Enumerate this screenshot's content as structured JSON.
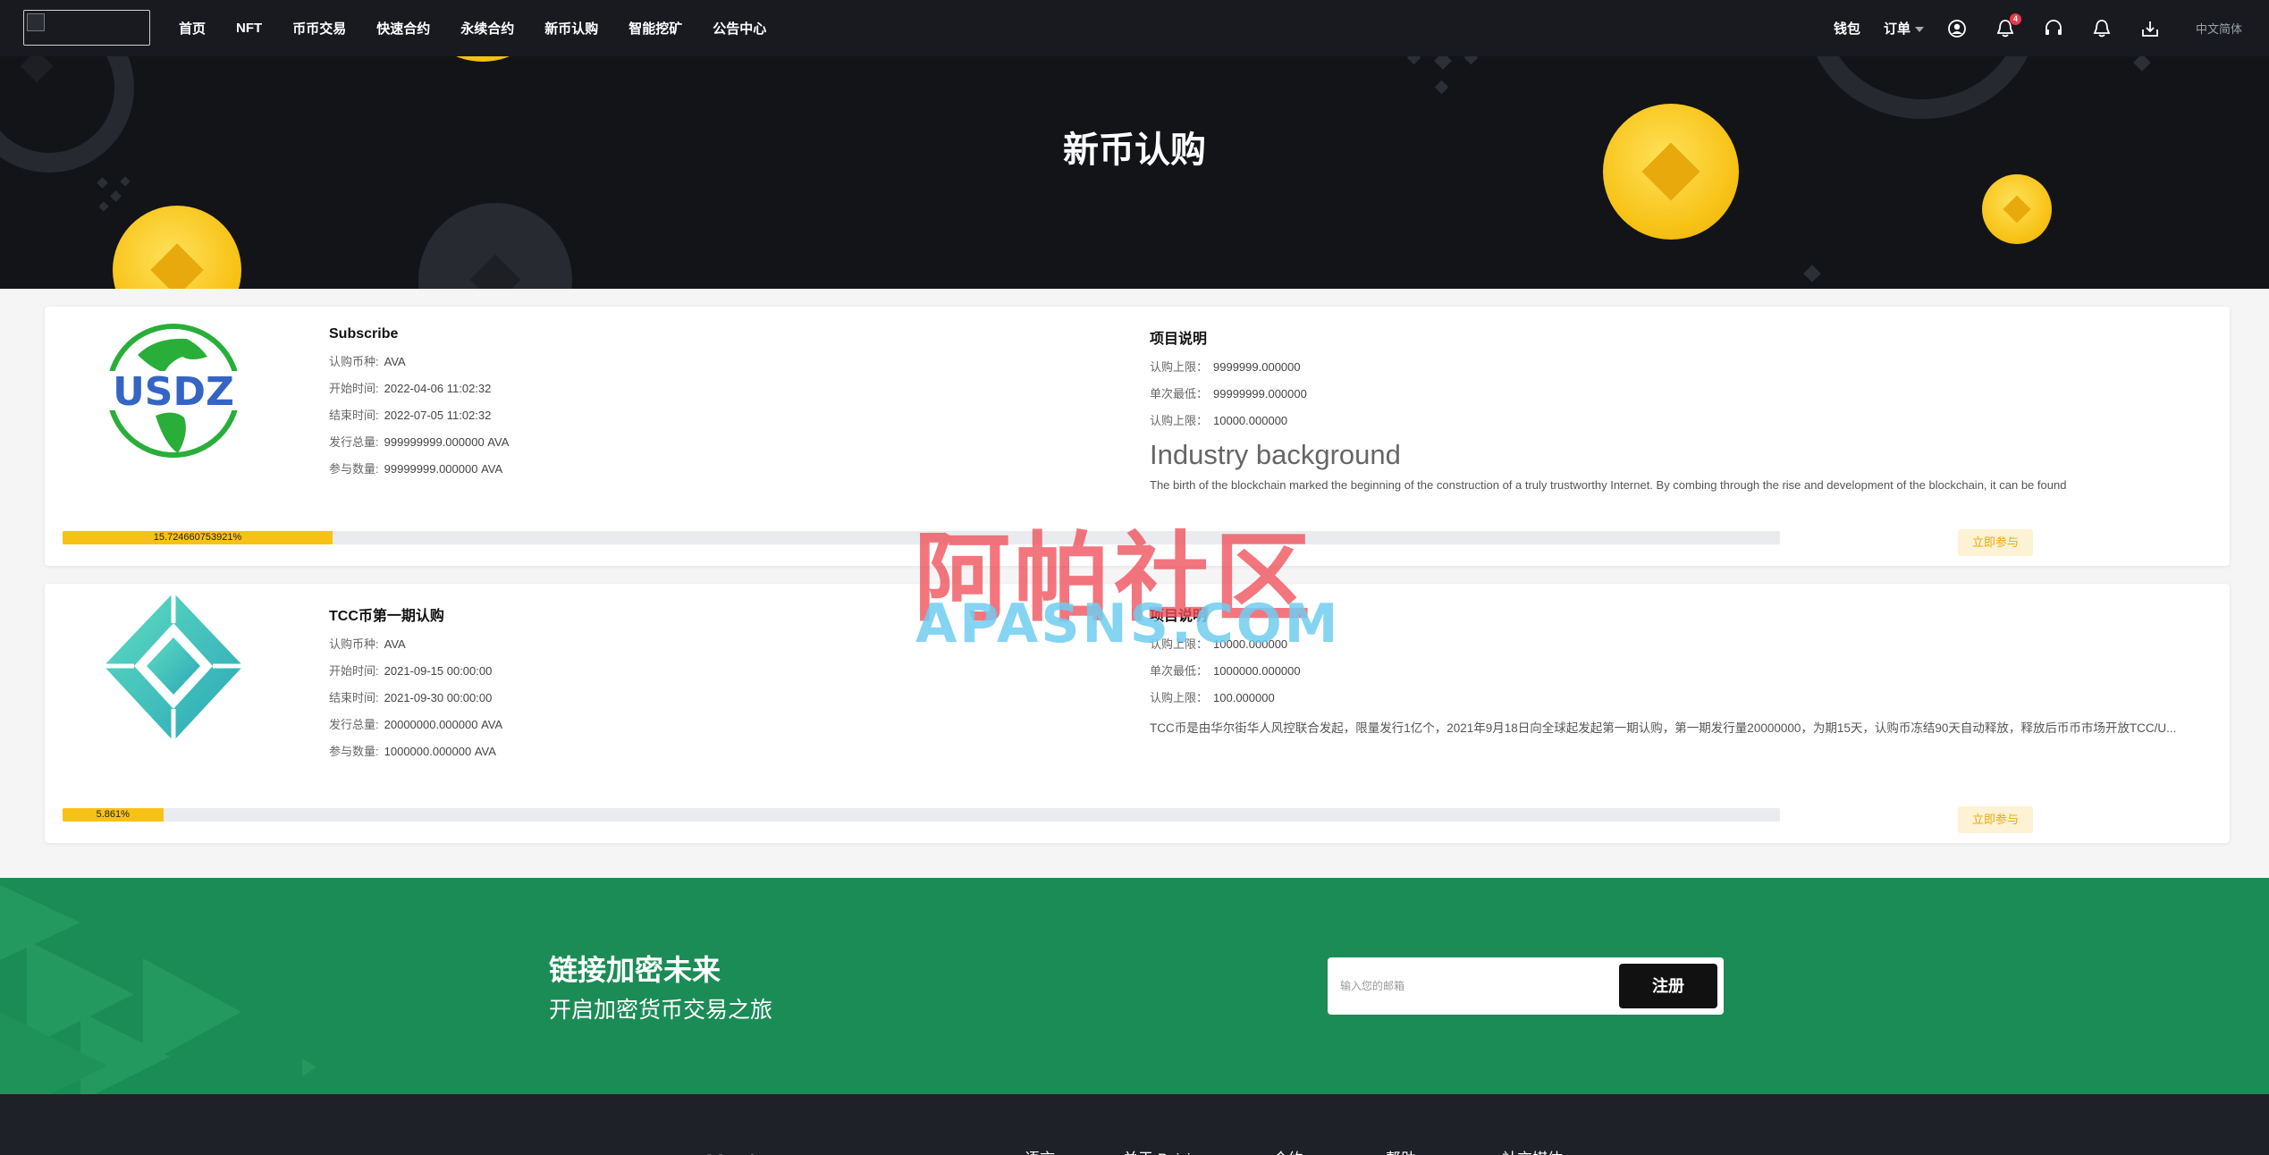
{
  "nav": {
    "items": [
      "首页",
      "NFT",
      "币币交易",
      "快速合约",
      "永续合约",
      "新币认购",
      "智能挖矿",
      "公告中心"
    ],
    "wallet": "钱包",
    "orders": "订单",
    "notification_count": "4",
    "language": "中文简体"
  },
  "banner": {
    "title": "新币认购"
  },
  "cards": [
    {
      "name": "Subscribe",
      "logo_text": "USDZ",
      "coin_label": "认购币种:",
      "coin": "AVA",
      "start_label": "开始时间:",
      "start": "2022-04-06 11:02:32",
      "end_label": "结束时间:",
      "end": "2022-07-05 11:02:32",
      "total_label": "发行总量:",
      "total": "999999999.000000 AVA",
      "participants_label": "参与数量:",
      "participants": "99999999.000000 AVA",
      "desc_title": "项目说明",
      "limit_label": "认购上限：",
      "limit": "9999999.000000",
      "min_label": "单次最低：",
      "min": "99999999.000000",
      "max_label": "认购上限：",
      "max": "10000.000000",
      "industry_title": "Industry background",
      "industry_body": "The birth of the blockchain marked the beginning of the construction of a truly trustworthy Internet. By combing through the rise and development of the blockchain, it can be found",
      "progress": 15.724660753921,
      "progress_text": "15.724660753921%",
      "join": "立即参与"
    },
    {
      "name": "TCC币第一期认购",
      "coin_label": "认购币种:",
      "coin": "AVA",
      "start_label": "开始时间:",
      "start": "2021-09-15 00:00:00",
      "end_label": "结束时间:",
      "end": "2021-09-30 00:00:00",
      "total_label": "发行总量:",
      "total": "20000000.000000 AVA",
      "participants_label": "参与数量:",
      "participants": "1000000.000000 AVA",
      "desc_title": "项目说明",
      "limit_label": "认购上限：",
      "limit": "10000.000000",
      "min_label": "单次最低：",
      "min": "1000000.000000",
      "max_label": "认购上限：",
      "max": "100.000000",
      "desc_body": "TCC币是由华尔街华人风控联合发起，限量发行1亿个，2021年9月18日向全球起发起第一期认购，第一期发行量20000000，为期15天，认购币冻结90天自动释放，释放后币币市场开放TCC/U...",
      "progress": 5.861,
      "progress_text": "5.861%",
      "join": "立即参与"
    }
  ],
  "watermark": {
    "cn": "阿帕社区",
    "en": "APASNS.COM"
  },
  "cta": {
    "title": "链接加密未来",
    "subtitle": "开启加密货币交易之旅",
    "email_placeholder": "输入您的邮箱",
    "register": "注册"
  },
  "footer": {
    "brand": "下载应用",
    "links": [
      "语言",
      "关于 Bajsi",
      "合约",
      "帮助",
      "社交媒体"
    ]
  },
  "colors": {
    "accent": "#f7c215",
    "green": "#1b8c56",
    "dark": "#181a20"
  }
}
